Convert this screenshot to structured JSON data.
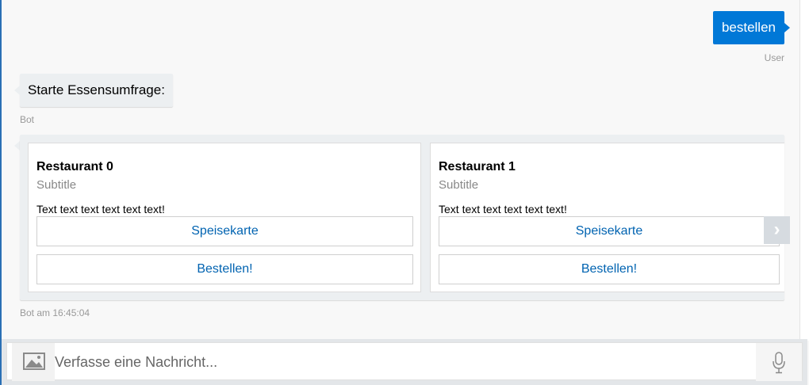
{
  "conversation": {
    "user_message": {
      "text": "bestellen",
      "sender": "User"
    },
    "bot_message": {
      "text": "Starte Essensumfrage:",
      "sender": "Bot"
    },
    "carousel": {
      "cards": [
        {
          "title": "Restaurant 0",
          "subtitle": "Subtitle",
          "text": "Text text text text text text!",
          "buttons": [
            "Speisekarte",
            "Bestellen!"
          ]
        },
        {
          "title": "Restaurant 1",
          "subtitle": "Subtitle",
          "text": "Text text text text text text!",
          "buttons": [
            "Speisekarte",
            "Bestellen!"
          ]
        }
      ],
      "next_icon": "chevron-right-icon",
      "meta": "Bot am 16:45:04"
    }
  },
  "composer": {
    "placeholder": "Verfasse eine Nachricht...",
    "image_icon": "image-icon",
    "mic_icon": "microphone-icon"
  },
  "colors": {
    "accent": "#0078d7",
    "link": "#0063b1",
    "bubble_bot": "#eceff1"
  }
}
